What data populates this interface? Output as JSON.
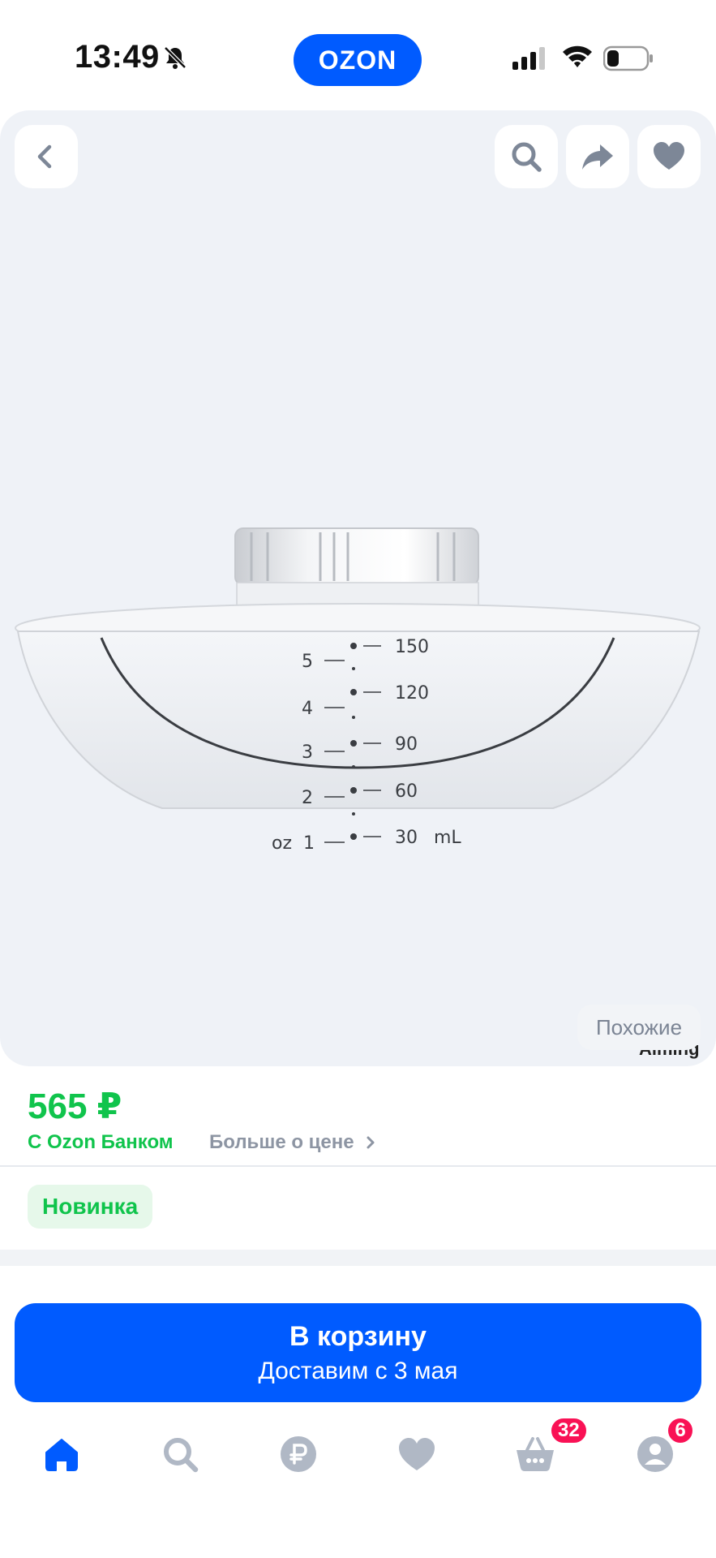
{
  "status_bar": {
    "time": "13:49",
    "icons": [
      "bell-muted-icon",
      "signal-icon",
      "wifi-icon",
      "battery-icon"
    ]
  },
  "app": {
    "logo_text": "OZON",
    "brand_color": "#005bff"
  },
  "gallery": {
    "top_buttons": [
      "back-icon",
      "search-icon",
      "share-icon",
      "heart-icon"
    ],
    "bottle_scale": {
      "oz": [
        "5",
        "4",
        "3",
        "2",
        "1"
      ],
      "oz_unit": "oz",
      "ml": [
        "150",
        "120",
        "90",
        "60",
        "30"
      ],
      "ml_unit": "mL"
    },
    "similar_label": "Похожие",
    "overlap_text": "Aiming"
  },
  "price_block": {
    "price": "565 ₽",
    "price_note": "С Ozon Банком",
    "more_price": "Больше о цене",
    "badge": "Новинка",
    "price_color": "#10c44c"
  },
  "cart": {
    "title": "В корзину",
    "subtitle": "Доставим с 3 мая"
  },
  "bottom_nav": {
    "items": [
      "home-icon",
      "search-icon",
      "ruble-icon",
      "heart-icon",
      "basket-icon",
      "profile-icon"
    ],
    "cart_badge": "32",
    "profile_badge": "6",
    "active_color": "#005bff",
    "inactive_color": "#b0b8c5",
    "badge_color": "#f91155"
  }
}
